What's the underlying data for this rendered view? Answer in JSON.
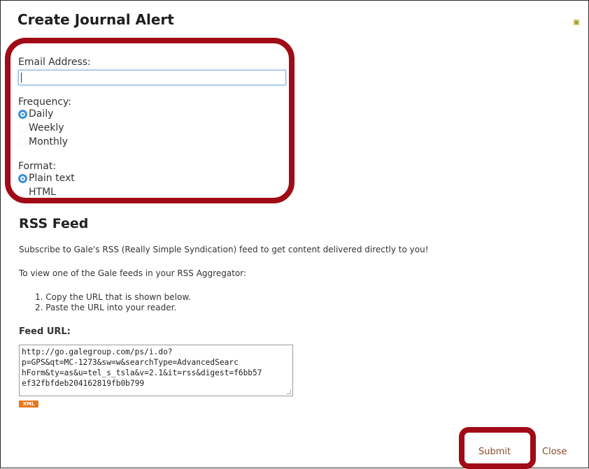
{
  "dialog": {
    "title": "Create Journal Alert"
  },
  "email": {
    "label": "Email Address:",
    "value": ""
  },
  "frequency": {
    "label": "Frequency:",
    "options": [
      "Daily",
      "Weekly",
      "Monthly"
    ],
    "selected": "Daily"
  },
  "format": {
    "label": "Format:",
    "options": [
      "Plain text",
      "HTML"
    ],
    "selected": "Plain text"
  },
  "rss": {
    "heading": "RSS Feed",
    "intro": "Subscribe to Gale's RSS (Really Simple Syndication) feed to get content delivered directly to you!",
    "instruction": "To view one of the Gale feeds in your RSS Aggregator:",
    "steps": [
      "1. Copy the URL that is shown below.",
      "2. Paste the URL into your reader."
    ],
    "feed_label": "Feed URL:",
    "feed_url": "http://go.galegroup.com/ps/i.do?\np=GPS&qt=MC-1273&sw=w&searchType=AdvancedSearc\nhForm&ty=as&u=tel_s_tsla&v=2.1&it=rss&digest=f6bb57\nef32fbfdeb204162819fb0b799",
    "xml_badge": "XML"
  },
  "actions": {
    "submit": "Submit",
    "close": "Close"
  },
  "colors": {
    "highlight": "#a00b16",
    "radio_checked": "#3f8fd6",
    "link": "#8a4b2a",
    "xml_badge": "#e8761c"
  },
  "icons": {
    "corner": "resize-icon"
  }
}
